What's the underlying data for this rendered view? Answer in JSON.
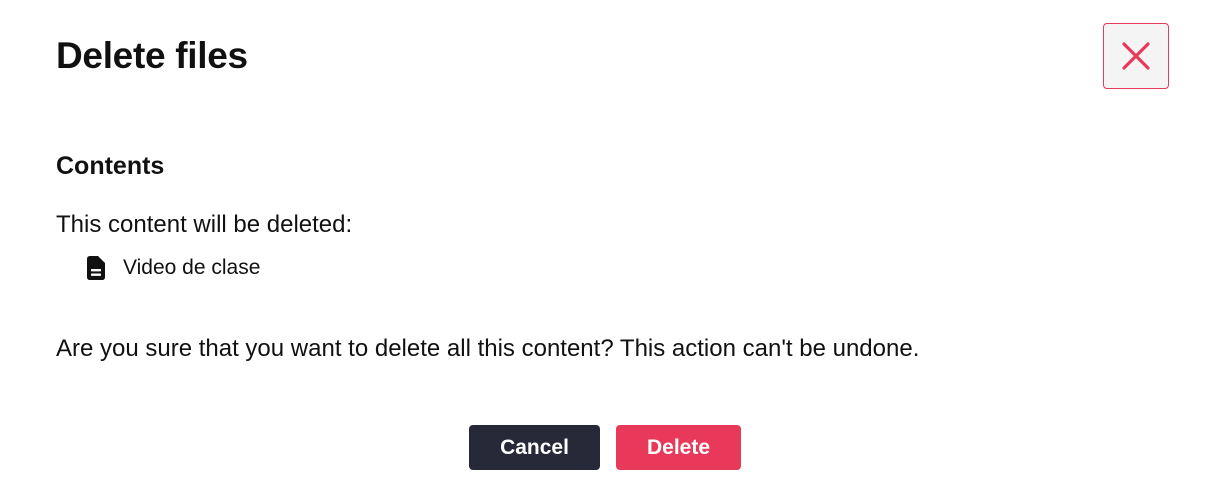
{
  "dialog": {
    "title": "Delete files",
    "close_icon": "close-x-icon",
    "section_title": "Contents",
    "intro_text": "This content will be deleted:",
    "files": [
      {
        "icon": "file-document-icon",
        "name": "Video de clase"
      }
    ],
    "confirm_text": "Are you sure that you want to delete all this content? This action can't be undone.",
    "cancel_label": "Cancel",
    "delete_label": "Delete"
  },
  "colors": {
    "accent": "#e8395a",
    "cancel_bg": "#272838",
    "close_bg": "#f4f4f5",
    "text": "#111111"
  }
}
